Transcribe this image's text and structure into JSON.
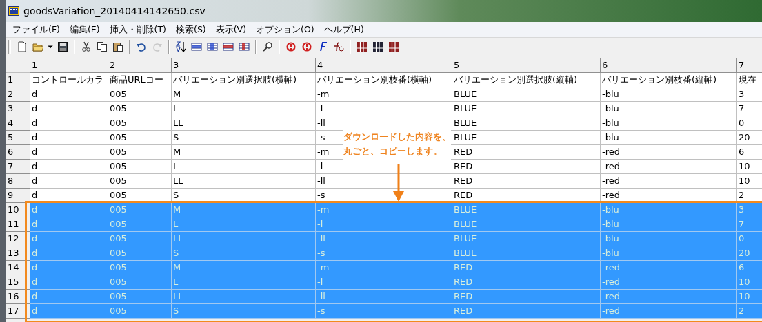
{
  "window": {
    "title": "goodsVariation_20140414142650.csv"
  },
  "menu": [
    "ファイル(F)",
    "編集(E)",
    "挿入・削除(T)",
    "検索(S)",
    "表示(V)",
    "オプション(O)",
    "ヘルプ(H)"
  ],
  "toolbar": [
    [
      {
        "kind": "new",
        "disabled": false
      },
      {
        "kind": "open",
        "disabled": false
      },
      {
        "kind": "dropdown",
        "disabled": false
      },
      {
        "kind": "save",
        "disabled": false
      }
    ],
    [
      {
        "kind": "cut",
        "disabled": false
      },
      {
        "kind": "copy",
        "disabled": false
      },
      {
        "kind": "paste",
        "disabled": false
      }
    ],
    [
      {
        "kind": "undo",
        "disabled": false
      },
      {
        "kind": "redo",
        "disabled": true
      }
    ],
    [
      {
        "kind": "sort",
        "disabled": false
      },
      {
        "kind": "insert-row",
        "disabled": false
      },
      {
        "kind": "insert-column",
        "disabled": false
      },
      {
        "kind": "delete-row",
        "disabled": false
      },
      {
        "kind": "delete-column",
        "disabled": false
      }
    ],
    [
      {
        "kind": "find",
        "disabled": false
      }
    ],
    [
      {
        "kind": "refresh",
        "disabled": false
      },
      {
        "kind": "refresh-all",
        "disabled": false
      },
      {
        "kind": "font",
        "disabled": false
      },
      {
        "kind": "function",
        "disabled": false
      }
    ],
    [
      {
        "kind": "grid-full",
        "disabled": false
      },
      {
        "kind": "grid-plain",
        "disabled": false
      },
      {
        "kind": "grid-header",
        "disabled": false
      }
    ]
  ],
  "table": {
    "columns": [
      "1",
      "2",
      "3",
      "4",
      "5",
      "6",
      "7"
    ],
    "rows": [
      {
        "row": "1",
        "selected": false,
        "cells": [
          "コントロールカラ",
          "商品URLコー",
          "バリエーション別選択肢(横軸)",
          "バリエーション別枝番(横軸)",
          "バリエーション別選択肢(縦軸)",
          "バリエーション別枝番(縦軸)",
          "現在"
        ]
      },
      {
        "row": "2",
        "selected": false,
        "cells": [
          "d",
          "005",
          "M",
          "-m",
          "BLUE",
          "-blu",
          "3"
        ]
      },
      {
        "row": "3",
        "selected": false,
        "cells": [
          "d",
          "005",
          "L",
          "-l",
          "BLUE",
          "-blu",
          "7"
        ]
      },
      {
        "row": "4",
        "selected": false,
        "cells": [
          "d",
          "005",
          "LL",
          "-ll",
          "BLUE",
          "-blu",
          "0"
        ]
      },
      {
        "row": "5",
        "selected": false,
        "cells": [
          "d",
          "005",
          "S",
          "-s",
          "BLUE",
          "-blu",
          "20"
        ]
      },
      {
        "row": "6",
        "selected": false,
        "cells": [
          "d",
          "005",
          "M",
          "-m",
          "RED",
          "-red",
          "6"
        ]
      },
      {
        "row": "7",
        "selected": false,
        "cells": [
          "d",
          "005",
          "L",
          "-l",
          "RED",
          "-red",
          "10"
        ]
      },
      {
        "row": "8",
        "selected": false,
        "cells": [
          "d",
          "005",
          "LL",
          "-ll",
          "RED",
          "-red",
          "10"
        ]
      },
      {
        "row": "9",
        "selected": false,
        "cells": [
          "d",
          "005",
          "S",
          "-s",
          "RED",
          "-red",
          "2"
        ]
      },
      {
        "row": "10",
        "selected": true,
        "cells": [
          "d",
          "005",
          "M",
          "-m",
          "BLUE",
          "-blu",
          "3"
        ]
      },
      {
        "row": "11",
        "selected": true,
        "cells": [
          "d",
          "005",
          "L",
          "-l",
          "BLUE",
          "-blu",
          "7"
        ]
      },
      {
        "row": "12",
        "selected": true,
        "cells": [
          "d",
          "005",
          "LL",
          "-ll",
          "BLUE",
          "-blu",
          "0"
        ]
      },
      {
        "row": "13",
        "selected": true,
        "cells": [
          "d",
          "005",
          "S",
          "-s",
          "BLUE",
          "-blu",
          "20"
        ]
      },
      {
        "row": "14",
        "selected": true,
        "cells": [
          "d",
          "005",
          "M",
          "-m",
          "RED",
          "-red",
          "6"
        ]
      },
      {
        "row": "15",
        "selected": true,
        "cells": [
          "d",
          "005",
          "L",
          "-l",
          "RED",
          "-red",
          "10"
        ]
      },
      {
        "row": "16",
        "selected": true,
        "cells": [
          "d",
          "005",
          "LL",
          "-ll",
          "RED",
          "-red",
          "10"
        ]
      },
      {
        "row": "17",
        "selected": true,
        "cells": [
          "d",
          "005",
          "S",
          "-s",
          "RED",
          "-red",
          "2"
        ]
      }
    ]
  },
  "callout": {
    "lines": [
      "ダウンロードした内容を、",
      "丸ごと、コピーします。"
    ]
  }
}
